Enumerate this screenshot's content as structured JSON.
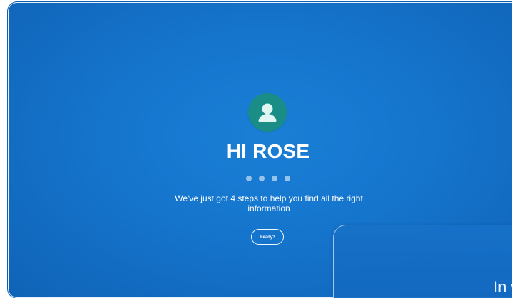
{
  "onboarding": {
    "greeting": "HI ROSE",
    "description": "We've just got 4 steps to help you find all the right information",
    "ready_button": "Ready?",
    "step_count": 4
  },
  "next_panel": {
    "visible_text": "In w"
  },
  "icons": {
    "avatar": "user-avatar-icon"
  },
  "colors": {
    "background": "#1677cf",
    "avatar": "#1a8e86",
    "text": "#ffffff"
  }
}
